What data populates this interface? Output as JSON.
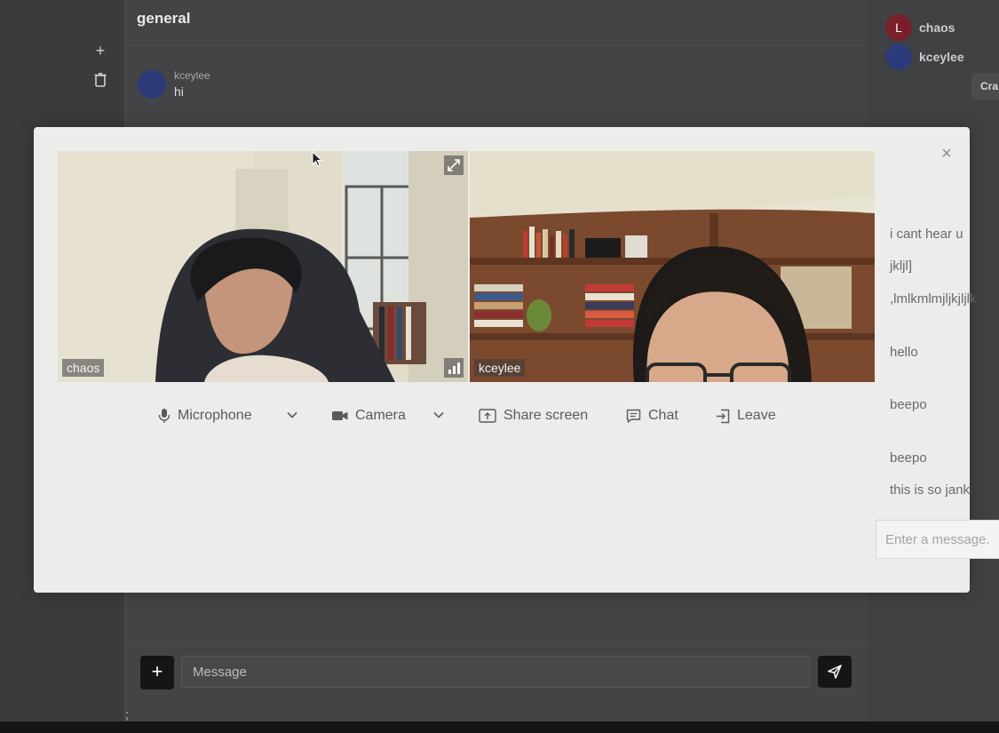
{
  "channel": {
    "title": "general"
  },
  "sidebar": {
    "add_icon": "plus-icon",
    "trash_icon": "trash-icon"
  },
  "messages": [
    {
      "author": "kceylee",
      "text": "hi"
    }
  ],
  "members": [
    {
      "initial": "L",
      "name": "chaos",
      "color": "#7a1f2a"
    },
    {
      "initial": "",
      "name": "kceylee",
      "color": "#2d3a7a"
    }
  ],
  "members_panel": {
    "create_label": "Cra"
  },
  "composer": {
    "placeholder": "Message",
    "add_icon": "plus-icon",
    "send_icon": "send-icon"
  },
  "footer": {
    "stray_char": ";"
  },
  "call": {
    "close_icon": "close-icon",
    "participants": [
      {
        "name": "chaos",
        "expand_icon": "expand-icon",
        "signal_icon": "signal-icon"
      },
      {
        "name": "kceylee"
      }
    ],
    "controls": {
      "microphone": "Microphone",
      "camera": "Camera",
      "share_screen": "Share screen",
      "chat": "Chat",
      "leave": "Leave"
    },
    "chat": {
      "messages": [
        "i cant hear u",
        "jkljl]",
        ",lmlkmlmjljkjljlkjkl",
        "hello",
        "beepo",
        "beepo",
        "this is so jank"
      ],
      "placeholder": "Enter a message..."
    }
  }
}
